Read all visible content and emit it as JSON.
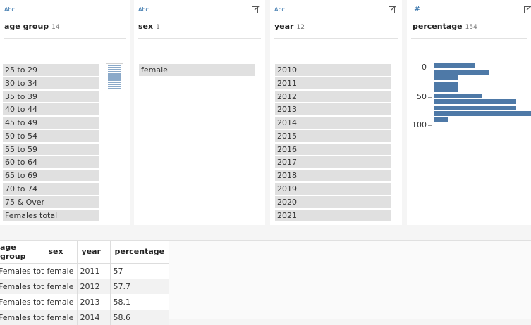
{
  "profiles": [
    {
      "type_label": "Abc",
      "name": "age group",
      "count": "14",
      "values": [
        "25 to 29",
        "30 to 34",
        "35 to 39",
        "40 to 44",
        "45 to 49",
        "50 to 54",
        "55 to 59",
        "60 to 64",
        "65 to 69",
        "70 to 74",
        "75 & Over",
        "Females total"
      ]
    },
    {
      "type_label": "Abc",
      "name": "sex",
      "count": "1",
      "values": [
        "female"
      ]
    },
    {
      "type_label": "Abc",
      "name": "year",
      "count": "12",
      "values": [
        "2010",
        "2011",
        "2012",
        "2013",
        "2014",
        "2015",
        "2016",
        "2017",
        "2018",
        "2019",
        "2020",
        "2021"
      ]
    },
    {
      "type_label": "#",
      "name": "percentage",
      "count": "154",
      "axis_ticks": [
        "0",
        "50",
        "100"
      ]
    }
  ],
  "chart_data": {
    "type": "bar",
    "orientation": "horizontal",
    "title": "",
    "categories": [
      "0-10",
      "10-20",
      "20-30",
      "30-40",
      "40-50",
      "50-60",
      "60-70",
      "70-80",
      "80-90",
      "90-100"
    ],
    "values": [
      17,
      23,
      10,
      10,
      10,
      20,
      34,
      34,
      40,
      6
    ],
    "ylabel": "",
    "xlabel": "",
    "y_ticks": [
      "0",
      "50",
      "100"
    ]
  },
  "table": {
    "columns": [
      "age group",
      "sex",
      "year",
      "percentage"
    ],
    "rows": [
      [
        "Females total",
        "female",
        "2011",
        "57"
      ],
      [
        "Females total",
        "female",
        "2012",
        "57.7"
      ],
      [
        "Females total",
        "female",
        "2013",
        "58.1"
      ],
      [
        "Females total",
        "female",
        "2014",
        "58.6"
      ]
    ]
  }
}
